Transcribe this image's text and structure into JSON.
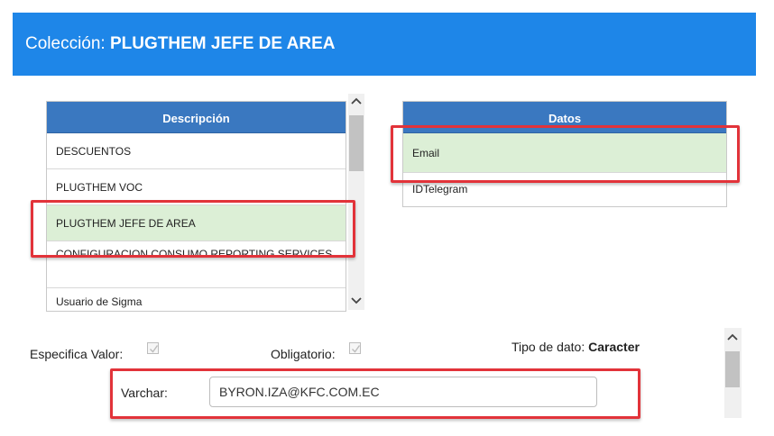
{
  "header": {
    "prefix": "Colección:",
    "collection": "PLUGTHEM JEFE DE AREA"
  },
  "description_table": {
    "header": "Descripción",
    "rows": [
      "DESCUENTOS",
      "PLUGTHEM VOC",
      "PLUGTHEM JEFE DE AREA",
      "CONFIGURACION CONSUMO REPORTING SERVICES",
      "Usuario de Sigma"
    ],
    "selected": "PLUGTHEM JEFE DE AREA"
  },
  "datos_table": {
    "header": "Datos",
    "rows": [
      "Email",
      "IDTelegram"
    ],
    "selected": "Email"
  },
  "form": {
    "especifica_label": "Especifica Valor:",
    "especifica_checked": true,
    "obligatorio_label": "Obligatorio:",
    "obligatorio_checked": true,
    "tipo_label": "Tipo de dato:",
    "tipo_value": "Caracter",
    "varchar_label": "Varchar:",
    "varchar_value": "BYRON.IZA@KFC.COM.EC"
  },
  "colors": {
    "header_bg": "#1e86e8",
    "table_header_bg": "#3a78c0",
    "selected_row": "#dcefd6",
    "highlight": "#e2333a"
  },
  "icons": [
    "chevron-up-icon",
    "chevron-down-icon",
    "checkmark-icon"
  ]
}
